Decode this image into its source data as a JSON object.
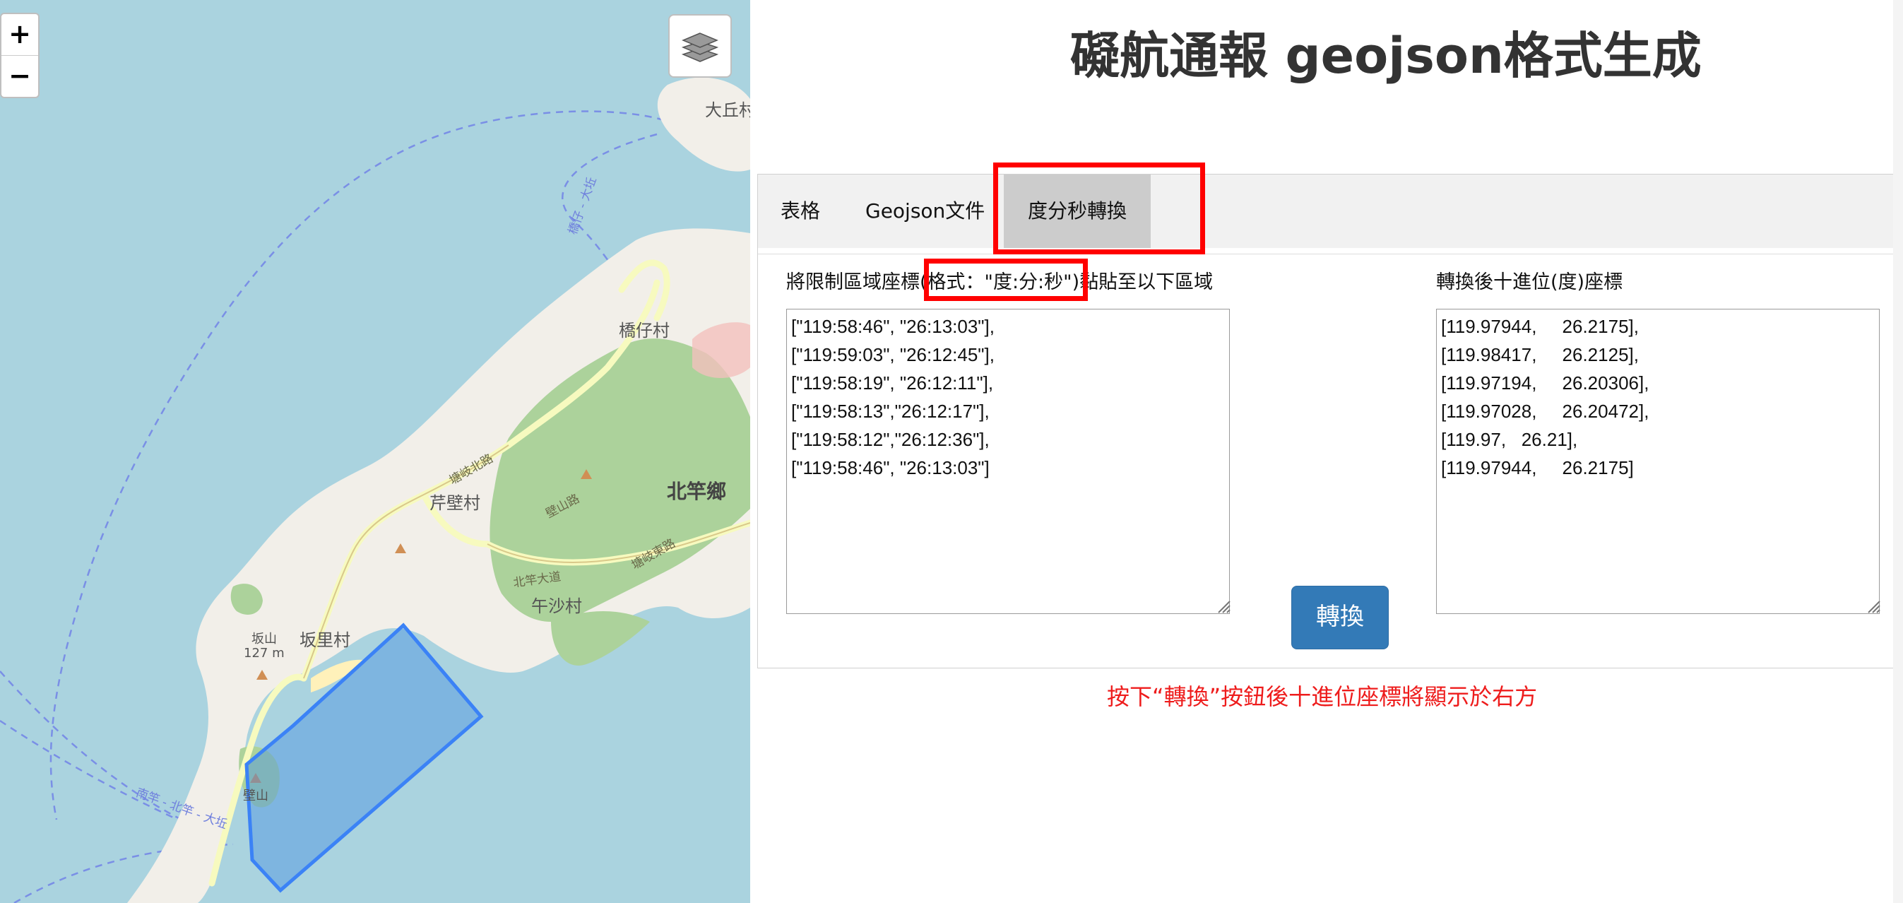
{
  "map": {
    "zoom_in": "+",
    "zoom_out": "−",
    "labels": [
      {
        "key": "dagiu",
        "text": "大丘村"
      },
      {
        "key": "qiaozai",
        "text": "橋仔村"
      },
      {
        "key": "qibi",
        "text": "芹壁村"
      },
      {
        "key": "beigan",
        "text": "北竿鄉"
      },
      {
        "key": "wusha",
        "text": "午沙村"
      },
      {
        "key": "banli",
        "text": "坂里村"
      },
      {
        "key": "banshan",
        "text": "坂山"
      },
      {
        "key": "banshan_elev",
        "text": "127 m"
      },
      {
        "key": "bishan_road",
        "text": "壁山路"
      },
      {
        "key": "beigan_road",
        "text": "北竿大道"
      },
      {
        "key": "tangqi",
        "text": "塘岐東路"
      },
      {
        "key": "tangqi2",
        "text": "塘岐北路"
      },
      {
        "key": "qiaozai_dagiu",
        "text": "橋仔 - 大坵"
      },
      {
        "key": "nangan_beigan",
        "text": "南竿 - 北竿 - 大坵"
      },
      {
        "key": "bishan",
        "text": "壁山"
      }
    ],
    "colors": {
      "water": "#aad3df",
      "land": "#f2efe9",
      "forest": "#acd29b",
      "polygon": "#4a90e2"
    }
  },
  "page": {
    "title": "礙航通報 geojson格式生成"
  },
  "tabs": [
    {
      "label": "表格"
    },
    {
      "label": "Geojson文件"
    },
    {
      "label": "度分秒轉換"
    }
  ],
  "converter": {
    "input_label": "將限制區域座標(格式：\"度:分:秒\")黏貼至以下區域",
    "output_label": "轉換後十進位(度)座標",
    "input_text": "[\"119:58:46\", \"26:13:03\"],\n[\"119:59:03\", \"26:12:45\"],\n[\"119:58:19\", \"26:12:11\"],\n[\"119:58:13\",\"26:12:17\"],\n[\"119:58:12\",\"26:12:36\"],\n[\"119:58:46\", \"26:13:03\"]",
    "output_text": "[119.97944,     26.2175],\n[119.98417,     26.2125],\n[119.97194,     26.20306],\n[119.97028,     26.20472],\n[119.97,   26.21],\n[119.97944,     26.2175]",
    "convert_button": "轉換",
    "hint": "按下“轉換”按鈕後十進位座標將顯示於右方"
  }
}
